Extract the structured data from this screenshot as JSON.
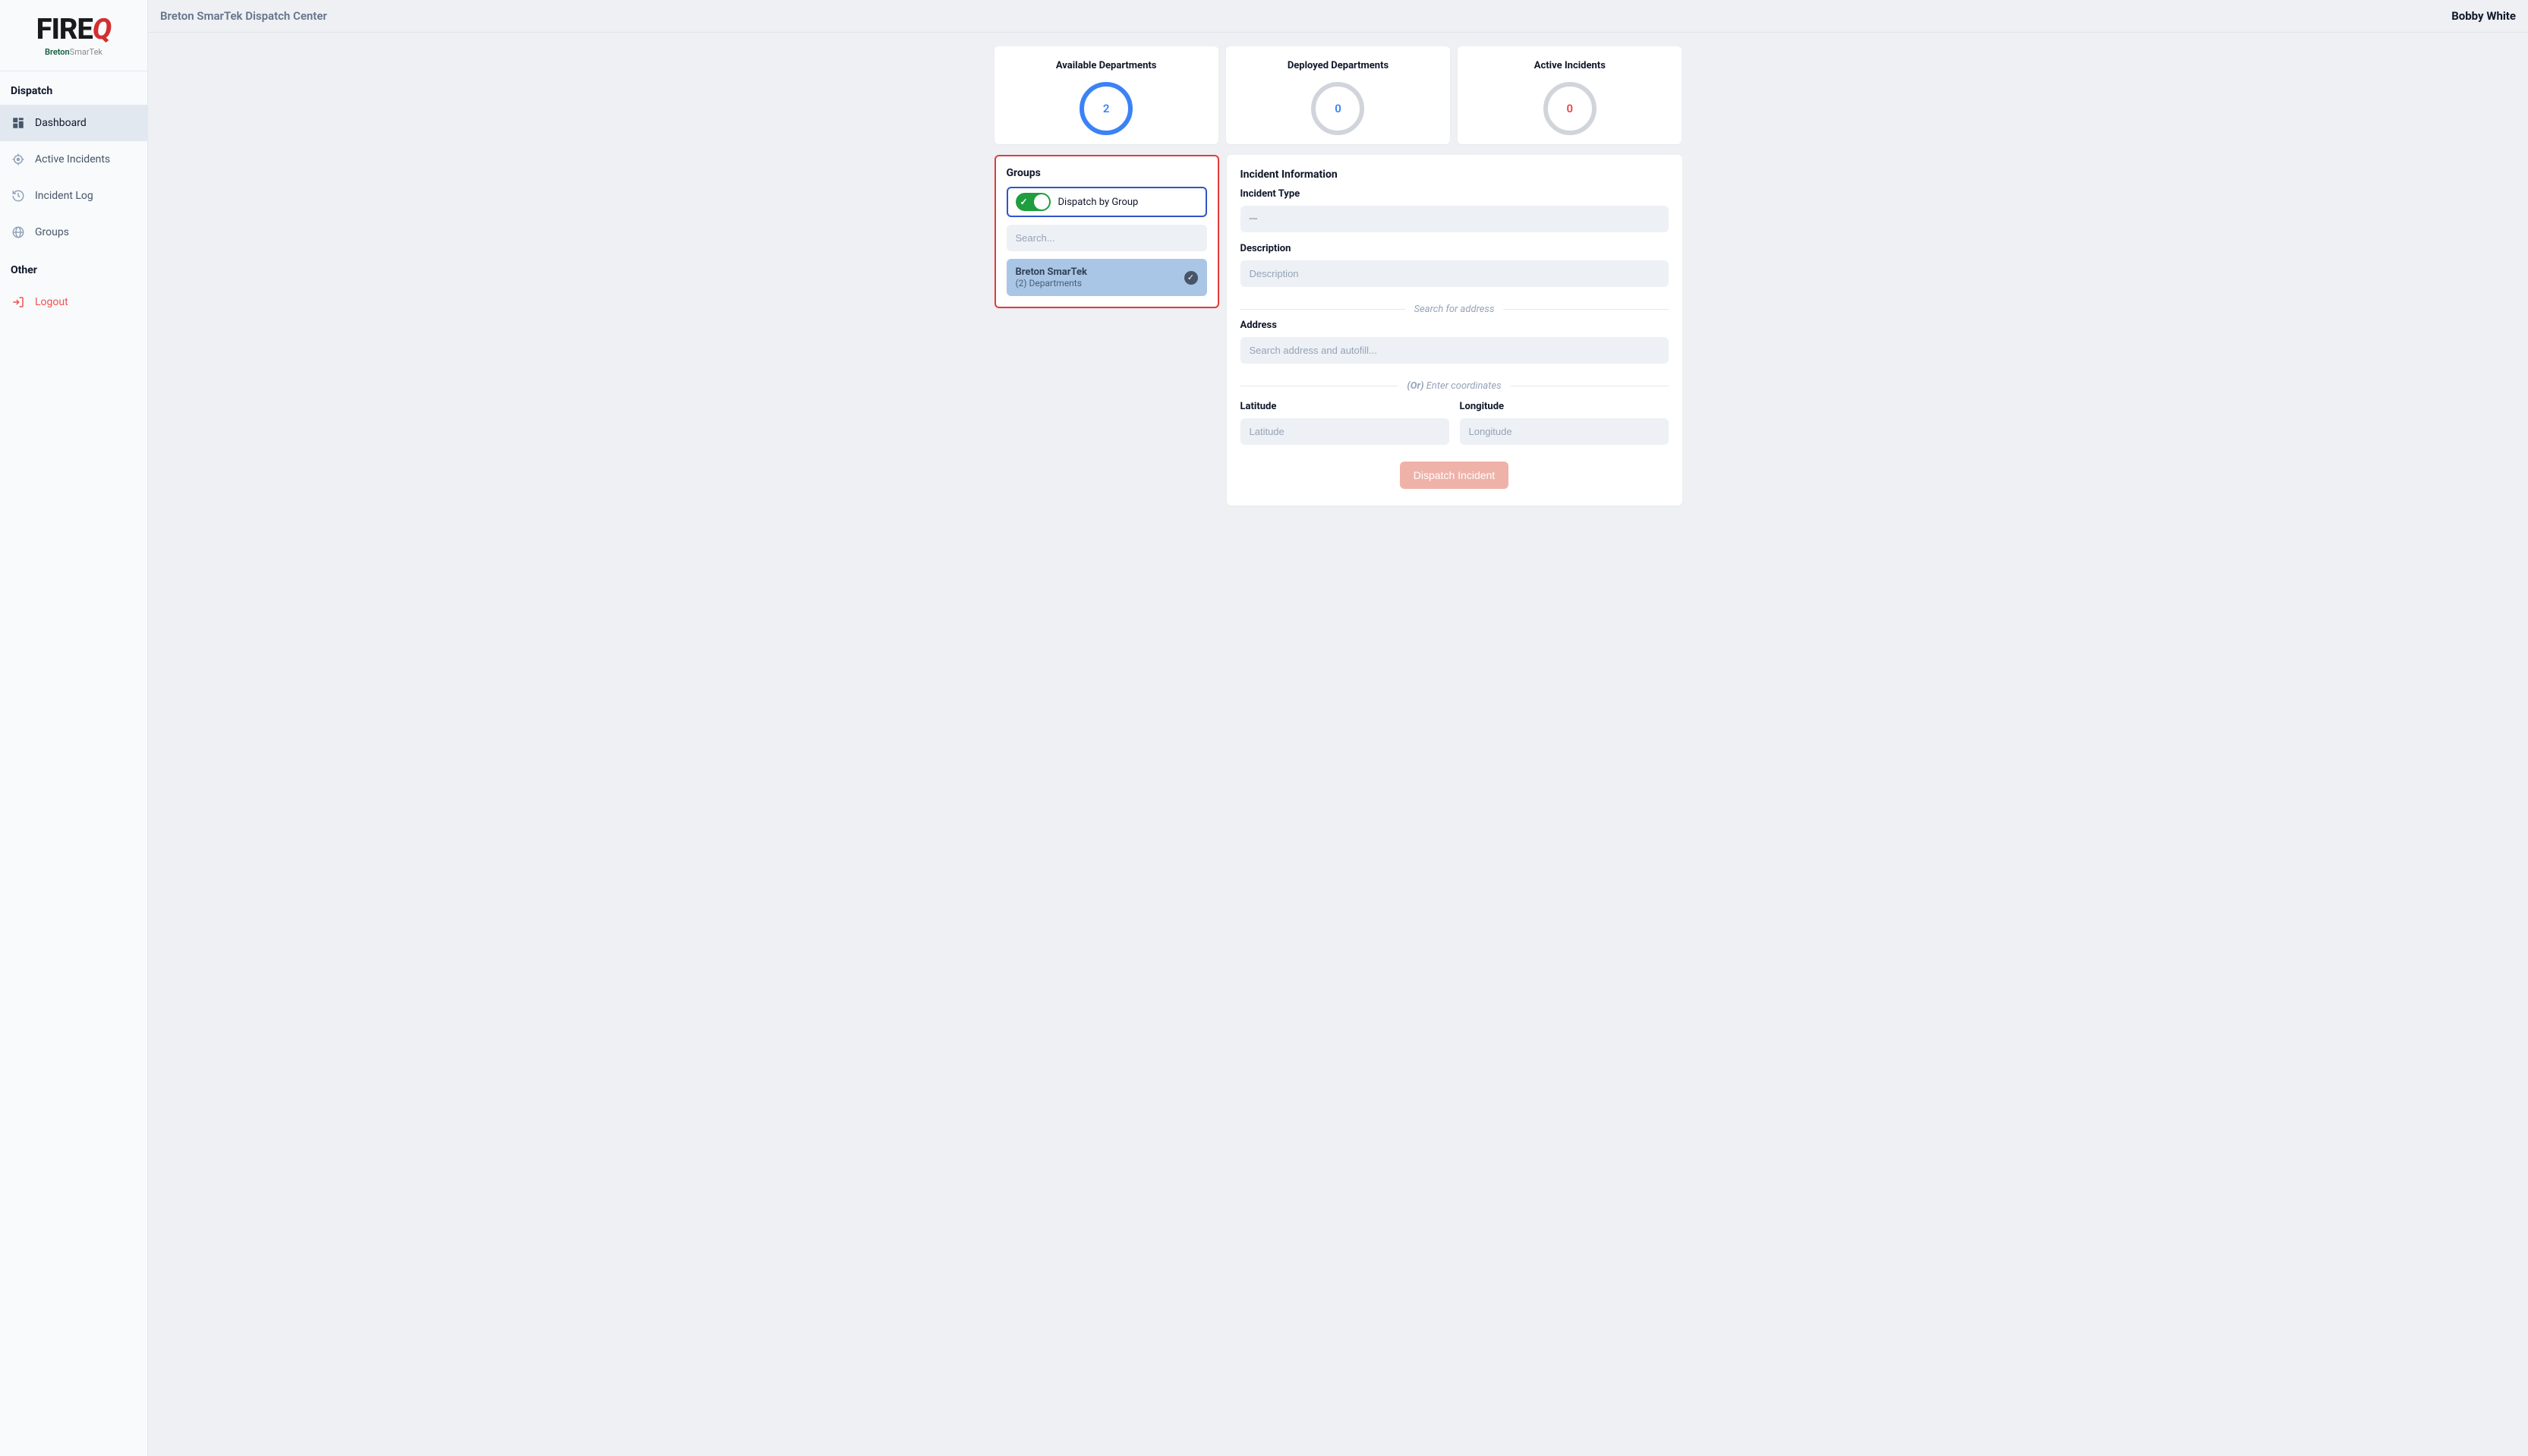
{
  "header": {
    "title": "Breton SmarTek Dispatch Center",
    "user": "Bobby White"
  },
  "logo": {
    "main_left": "FIRE",
    "main_right": "Q",
    "sub_bold": "Breton",
    "sub_thin": "SmarTek"
  },
  "sidebar": {
    "section1": "Dispatch",
    "items": [
      {
        "label": "Dashboard"
      },
      {
        "label": "Active Incidents"
      },
      {
        "label": "Incident Log"
      },
      {
        "label": "Groups"
      }
    ],
    "section2": "Other",
    "logout": "Logout"
  },
  "stats": {
    "available": {
      "title": "Available Departments",
      "value": "2"
    },
    "deployed": {
      "title": "Deployed Departments",
      "value": "0"
    },
    "active": {
      "title": "Active Incidents",
      "value": "0"
    }
  },
  "groups": {
    "heading": "Groups",
    "toggle_label": "Dispatch by Group",
    "search_placeholder": "Search...",
    "item": {
      "name": "Breton SmarTek",
      "sub": "(2) Departments"
    }
  },
  "incident": {
    "heading": "Incident Information",
    "type_label": "Incident Type",
    "type_value": "---",
    "description_label": "Description",
    "description_placeholder": "Description",
    "search_address_divider": "Search for address",
    "address_label": "Address",
    "address_placeholder": "Search address and autofill...",
    "or_text": "(Or)",
    "enter_coords_text": "Enter coordinates",
    "lat_label": "Latitude",
    "lat_placeholder": "Latitude",
    "lon_label": "Longitude",
    "lon_placeholder": "Longitude",
    "button": "Dispatch Incident"
  }
}
